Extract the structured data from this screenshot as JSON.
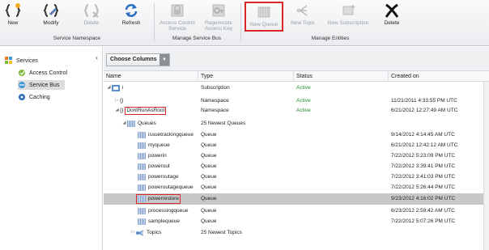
{
  "ribbon": {
    "new_label": "New",
    "modify_label": "Modify",
    "delete_label": "Delete",
    "refresh_label": "Refresh",
    "access_control_label": "Access Control Service",
    "regenerate_label": "Regenerate Access Key",
    "new_queue_label": "New Queue",
    "new_topic_label": "New Topic",
    "new_subscription_label": "New Subscription",
    "delete_entity_label": "Delete",
    "group_service_namespace": "Service Namespace",
    "group_manage_service_bus": "Manage Service Bus",
    "group_manage_entities": "Manage Entities"
  },
  "nav": {
    "services": "Services",
    "access_control": "Access Control",
    "service_bus": "Service Bus",
    "caching": "Caching"
  },
  "toolbar": {
    "choose_columns": "Choose Columns"
  },
  "columns": {
    "name": "Name",
    "type": "Type",
    "status": "Status",
    "created": "Created on"
  },
  "rows": [
    {
      "name": "i",
      "type": "Subscription",
      "status": "Active",
      "created": ""
    },
    {
      "name": "{}",
      "type": "Namespace",
      "status": "Active",
      "created": "11/21/2011 4:33:55 PM UTC"
    },
    {
      "name": "DontRunAsRoot",
      "type": "Namespace",
      "status": "Active",
      "created": "6/21/2012 12:27:49 AM UTC"
    },
    {
      "name": "Queues",
      "type": "25 Newest Queues",
      "status": "",
      "created": ""
    },
    {
      "name": "issuetrackingqueue",
      "type": "Queue",
      "status": "",
      "created": "9/14/2012 4:14:45 AM UTC"
    },
    {
      "name": "myqueue",
      "type": "Queue",
      "status": "",
      "created": "6/21/2012 12:42:12 AM UTC"
    },
    {
      "name": "powerin",
      "type": "Queue",
      "status": "",
      "created": "7/22/2012 5:23:09 PM UTC"
    },
    {
      "name": "powerout",
      "type": "Queue",
      "status": "",
      "created": "7/22/2012 3:39:41 PM UTC"
    },
    {
      "name": "poweroutage",
      "type": "Queue",
      "status": "",
      "created": "7/22/2012 3:41:03 PM UTC"
    },
    {
      "name": "poweroutagequeue",
      "type": "Queue",
      "status": "",
      "created": "7/22/2012 5:26:44 PM UTC"
    },
    {
      "name": "powerrestore",
      "type": "Queue",
      "status": "",
      "created": "9/23/2012 4:16:02 PM UTC"
    },
    {
      "name": "processingqueue",
      "type": "Queue",
      "status": "",
      "created": "6/23/2012 2:59:42 AM UTC"
    },
    {
      "name": "samplequeue",
      "type": "Queue",
      "status": "",
      "created": "7/22/2012 5:07:26 PM UTC"
    },
    {
      "name": "Topics",
      "type": "25 Newest Topics",
      "status": "",
      "created": ""
    }
  ],
  "colors": {
    "active": "#2a8a2a",
    "highlight": "#d9262b",
    "selection": "#c8c8c8"
  }
}
